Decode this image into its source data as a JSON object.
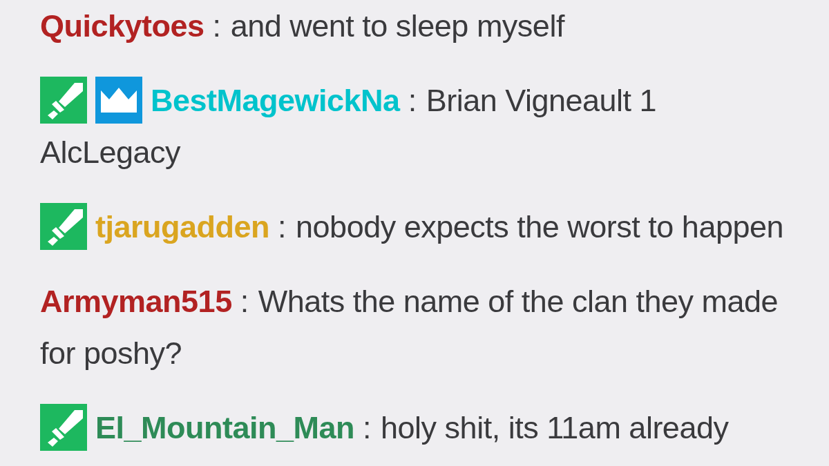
{
  "messages": [
    {
      "user": "Quickytoes",
      "color": "#b22222",
      "colon": ":",
      "lines": [
        "and went to sleep myself"
      ]
    },
    {
      "badges": [
        {
          "kind": "sword"
        },
        {
          "kind": "crown"
        }
      ],
      "user": "BestMagewickNa",
      "color": "#00c3cc",
      "colon": ":",
      "lines": [
        "Brian Vigneault 1",
        "AlcLegacy"
      ]
    },
    {
      "badges": [
        {
          "kind": "sword"
        }
      ],
      "user": "tjarugadden",
      "color": "#daa520",
      "colon": ":",
      "lines": [
        "nobody expects the worst to happen"
      ]
    },
    {
      "user": "Armyman515",
      "color": "#b22222",
      "colon": ":",
      "lines": [
        "Whats the name of the clan they made",
        "for poshy?"
      ]
    },
    {
      "badges": [
        {
          "kind": "sword"
        }
      ],
      "user": "El_Mountain_Man",
      "color": "#2e8b57",
      "colon": ":",
      "lines": [
        "holy shit, its 11am already"
      ]
    }
  ]
}
